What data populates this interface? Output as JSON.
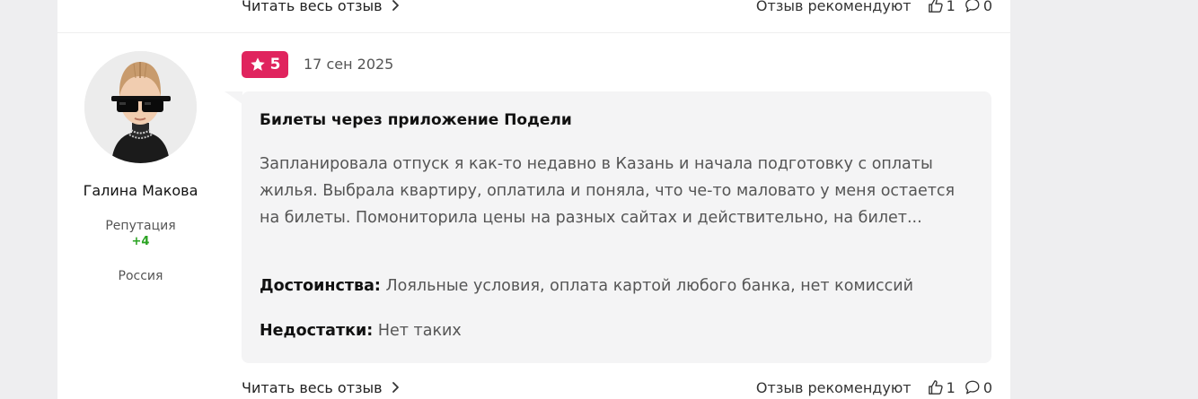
{
  "previous_review_footer": {
    "read_more": "Читать весь отзыв",
    "recommend_label": "Отзыв рекомендуют",
    "likes": "1",
    "comments": "0"
  },
  "review": {
    "author": {
      "name": "Галина Макова",
      "reputation_label": "Репутация",
      "reputation_value": "+4",
      "country": "Россия"
    },
    "rating": "5",
    "date": "17 сен 2025",
    "title": "Билеты через приложение Подели",
    "text": "Запланировала отпуск я как-то недавно в Казань и начала подготовку с оплаты жилья. Выбрала квартиру, оплатила и поняла, что че-то маловато у меня остается на билеты. Помониторила цены на разных сайтах и действительно, на билет...",
    "pros_label": "Достоинства:",
    "pros": "Лояльные условия, оплата картой любого банка, нет комиссий",
    "cons_label": "Недостатки:",
    "cons": "Нет таких",
    "footer": {
      "read_more": "Читать весь отзыв",
      "recommend_label": "Отзыв рекомендуют",
      "likes": "1",
      "comments": "0"
    }
  },
  "colors": {
    "rating_badge": "#e0245e",
    "reputation_positive": "#2aa322",
    "bubble_bg": "#f4f4f5",
    "page_bg": "#eeeef0"
  },
  "icons": [
    "chevron-right-icon",
    "thumbs-up-icon",
    "comment-icon",
    "star-icon"
  ]
}
